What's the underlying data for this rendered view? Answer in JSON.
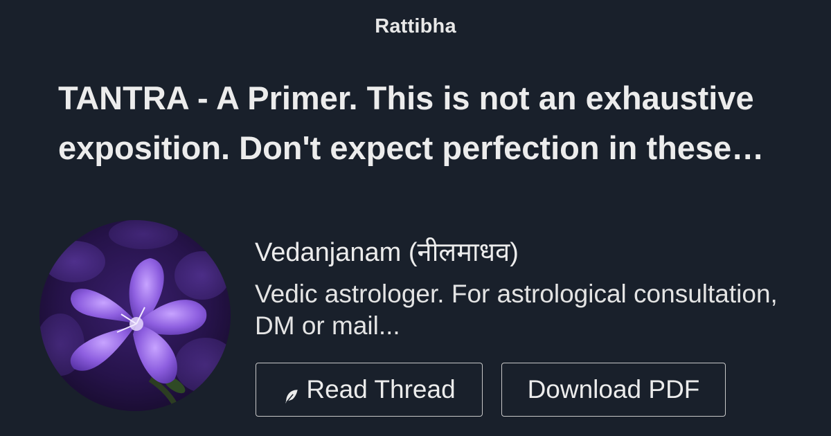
{
  "site": {
    "brand": "Rattibha"
  },
  "thread": {
    "title": "TANTRA - A Primer. This is not an exhaustive exposition. Don't expect perfection in these…"
  },
  "author": {
    "name": "Vedanjanam (नीलमाधव)",
    "bio": "Vedic astrologer. For astrological consultation, DM or mail...",
    "avatar_icon": "purple-bellflower-photo"
  },
  "actions": {
    "read_label": "Read Thread",
    "read_icon": "feather-icon",
    "download_label": "Download PDF"
  },
  "colors": {
    "background": "#19202b",
    "text": "#ececec",
    "button_border": "#c9c9c9"
  }
}
